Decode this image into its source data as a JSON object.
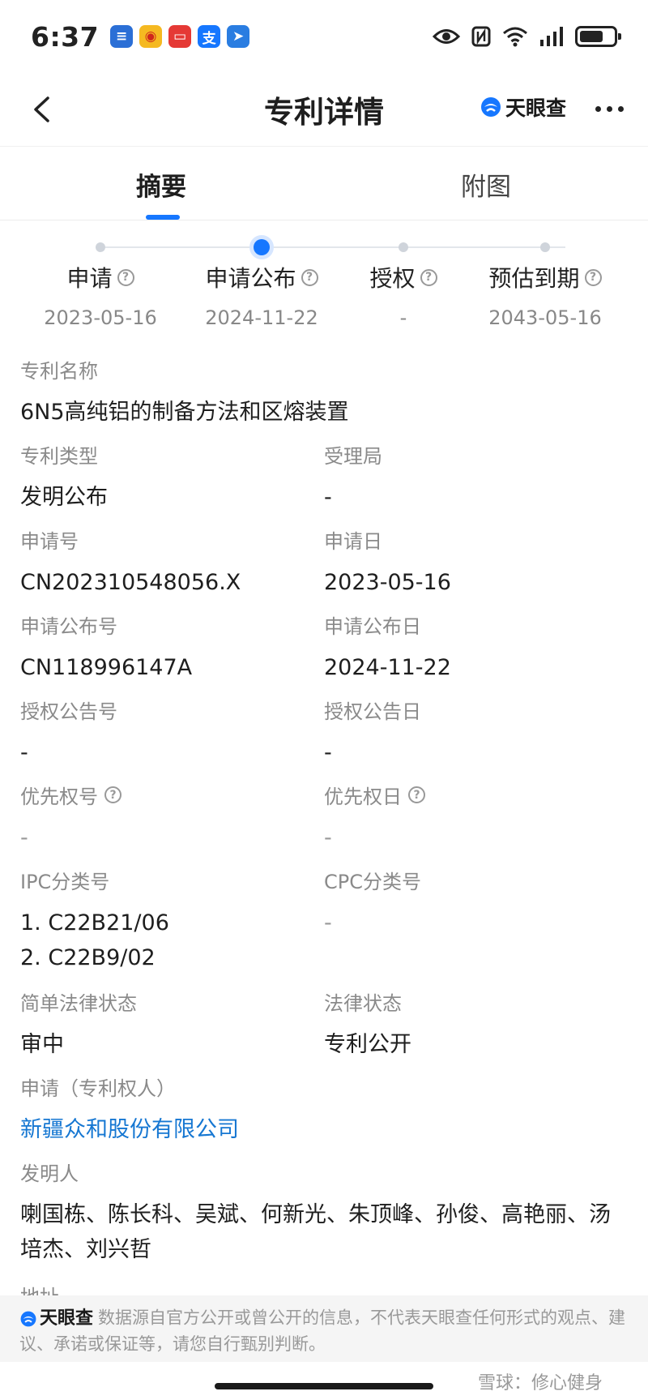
{
  "status_bar": {
    "time": "6:37",
    "notification_icons": [
      "message-app-icon",
      "weibo-icon",
      "mail-app-icon",
      "alipay-icon",
      "map-app-icon"
    ],
    "system_icons": [
      "eye-icon",
      "nfc-icon",
      "wifi-icon",
      "signal-icon",
      "battery-icon"
    ]
  },
  "header": {
    "title": "专利详情",
    "brand": "天眼查"
  },
  "tabs": [
    {
      "label": "摘要",
      "active": true
    },
    {
      "label": "附图",
      "active": false
    }
  ],
  "timeline": [
    {
      "label": "申请",
      "date": "2023-05-16",
      "active": false
    },
    {
      "label": "申请公布",
      "date": "2024-11-22",
      "active": true
    },
    {
      "label": "授权",
      "date": "-",
      "active": false
    },
    {
      "label": "预估到期",
      "date": "2043-05-16",
      "active": false
    }
  ],
  "fields": {
    "patent_name": {
      "label": "专利名称",
      "value": "6N5高纯铝的制备方法和区熔装置"
    },
    "patent_type": {
      "label": "专利类型",
      "value": "发明公布"
    },
    "office": {
      "label": "受理局",
      "value": "-"
    },
    "app_no": {
      "label": "申请号",
      "value": "CN202310548056.X"
    },
    "app_date": {
      "label": "申请日",
      "value": "2023-05-16"
    },
    "pub_no": {
      "label": "申请公布号",
      "value": "CN118996147A"
    },
    "pub_date": {
      "label": "申请公布日",
      "value": "2024-11-22"
    },
    "grant_no": {
      "label": "授权公告号",
      "value": "-"
    },
    "grant_date": {
      "label": "授权公告日",
      "value": "-"
    },
    "priority_no": {
      "label": "优先权号",
      "value": "-"
    },
    "priority_date": {
      "label": "优先权日",
      "value": "-"
    },
    "ipc": {
      "label": "IPC分类号",
      "values": [
        "1. C22B21/06",
        "2. C22B9/02"
      ]
    },
    "cpc": {
      "label": "CPC分类号",
      "value": "-"
    },
    "simple_legal_status": {
      "label": "简单法律状态",
      "value": "审中"
    },
    "legal_status": {
      "label": "法律状态",
      "value": "专利公开"
    },
    "applicant": {
      "label": "申请（专利权人）",
      "value": "新疆众和股份有限公司"
    },
    "inventors": {
      "label": "发明人",
      "value": "喇国栋、陈长科、吴斌、何新光、朱顶峰、孙俊、高艳丽、汤培杰、刘兴哲"
    },
    "address": {
      "label": "地址"
    }
  },
  "footer": {
    "brand": "天眼查",
    "disclaimer": "数据源自官方公开或曾公开的信息，不代表天眼查任何形式的观点、建议、承诺或保证等，请您自行甄别判断。"
  },
  "watermark": "雪球：修心健身",
  "colors": {
    "accent": "#1677ff",
    "link": "#1677d2",
    "label": "#8a8a8a"
  }
}
